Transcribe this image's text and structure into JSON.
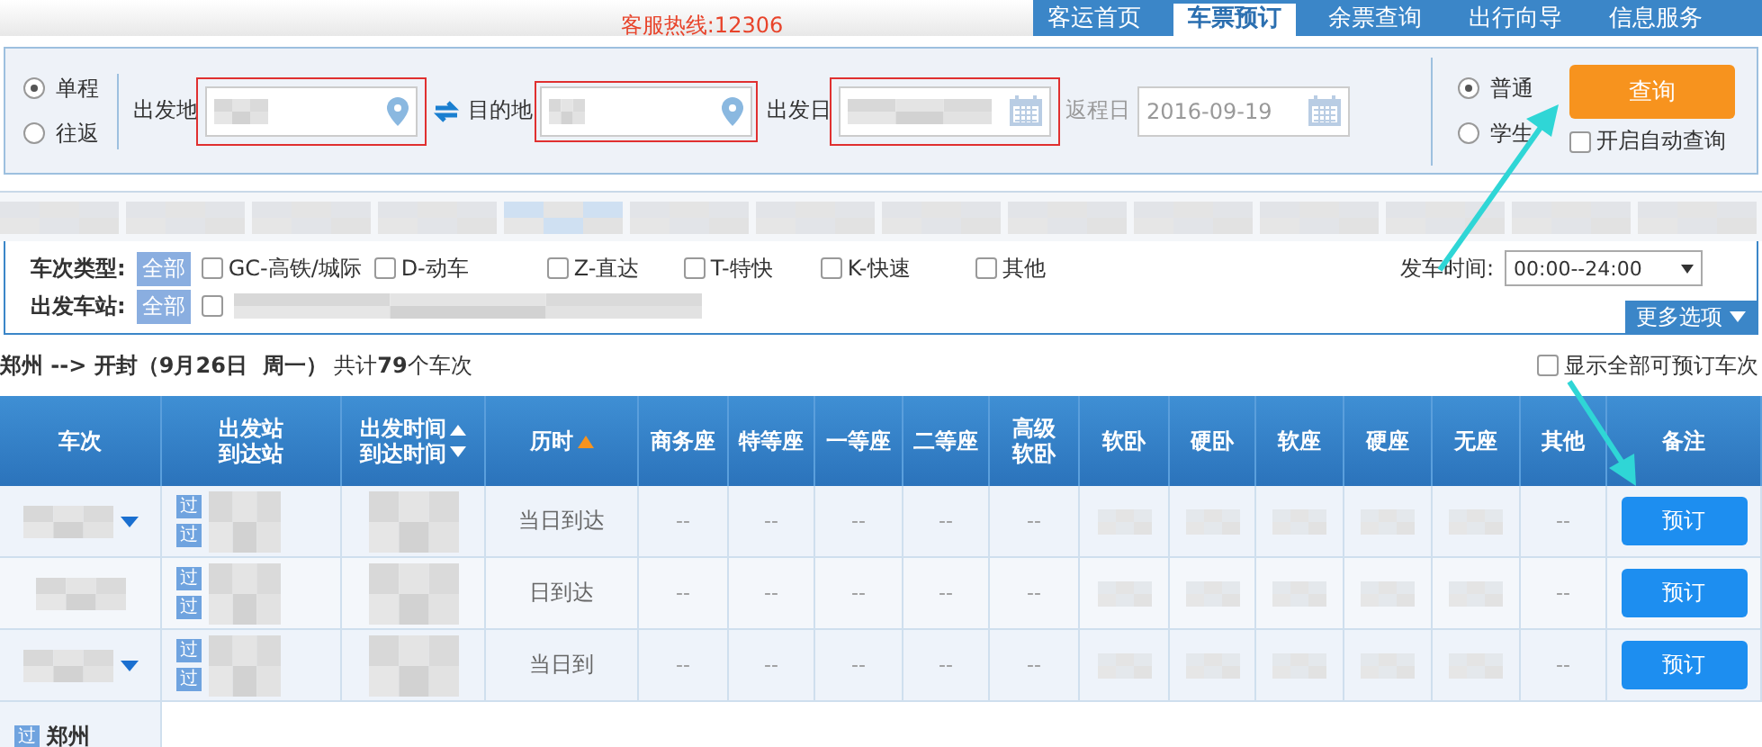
{
  "header": {
    "hotline": "客服热线:12306",
    "nav": [
      {
        "label": "客运首页",
        "selected": false
      },
      {
        "label": "车票预订",
        "selected": true
      },
      {
        "label": "余票查询",
        "selected": false
      },
      {
        "label": "出行向导",
        "selected": false
      },
      {
        "label": "信息服务",
        "selected": false
      }
    ]
  },
  "search": {
    "trip_types": [
      {
        "label": "单程",
        "selected": true
      },
      {
        "label": "往返",
        "selected": false
      }
    ],
    "from_label": "出发地",
    "to_label": "目的地",
    "date_label": "出发日",
    "return_label": "返程日",
    "return_date": "2016-09-19",
    "passenger_types": [
      {
        "label": "普通",
        "selected": true
      },
      {
        "label": "学生",
        "selected": false
      }
    ],
    "query_button": "查询",
    "auto_query": {
      "label": "开启自动查询",
      "checked": false
    }
  },
  "filters": {
    "type_label": "车次类型:",
    "type_all": "全部",
    "train_types": [
      {
        "label": "GC-高铁/城际",
        "checked": false
      },
      {
        "label": "D-动车",
        "checked": false
      },
      {
        "label": "Z-直达",
        "checked": false
      },
      {
        "label": "T-特快",
        "checked": false
      },
      {
        "label": "K-快速",
        "checked": false
      },
      {
        "label": "其他",
        "checked": false
      }
    ],
    "time_label": "发车时间:",
    "time_value": "00:00--24:00",
    "station_label": "出发车站:",
    "station_all": "全部",
    "station_checkbox": {
      "checked": false
    },
    "more_button": "更多选项"
  },
  "summary": {
    "route": "郑州 --> 开封（9月26日  周一）",
    "count": "共计**79**个车次",
    "show_all": {
      "label": "显示全部可预订车次",
      "checked": false
    }
  },
  "table": {
    "columns": [
      {
        "lines": [
          "车次"
        ],
        "kind": "plain"
      },
      {
        "lines": [
          "出发站",
          "到达站"
        ],
        "kind": "plain"
      },
      {
        "lines": [
          "出发时间",
          "到达时间"
        ],
        "kind": "sortboth"
      },
      {
        "lines": [
          "历时"
        ],
        "kind": "sortup"
      },
      {
        "lines": [
          "商务座"
        ],
        "kind": "plain"
      },
      {
        "lines": [
          "特等座"
        ],
        "kind": "plain"
      },
      {
        "lines": [
          "一等座"
        ],
        "kind": "plain"
      },
      {
        "lines": [
          "二等座"
        ],
        "kind": "plain"
      },
      {
        "lines": [
          "高级",
          "软卧"
        ],
        "kind": "plain"
      },
      {
        "lines": [
          "软卧"
        ],
        "kind": "plain"
      },
      {
        "lines": [
          "硬卧"
        ],
        "kind": "plain"
      },
      {
        "lines": [
          "软座"
        ],
        "kind": "plain"
      },
      {
        "lines": [
          "硬座"
        ],
        "kind": "plain"
      },
      {
        "lines": [
          "无座"
        ],
        "kind": "plain"
      },
      {
        "lines": [
          "其他"
        ],
        "kind": "plain"
      },
      {
        "lines": [
          "备注"
        ],
        "kind": "plain"
      }
    ],
    "rows": [
      {
        "caret": true,
        "via": [
          "过",
          "过"
        ],
        "duration": "当日到达",
        "seats": [
          {
            "kind": "text",
            "text": "--"
          },
          {
            "kind": "text",
            "text": "--"
          },
          {
            "kind": "text",
            "text": "--"
          },
          {
            "kind": "text",
            "text": "--"
          },
          {
            "kind": "text",
            "text": "--"
          },
          {
            "kind": "picture"
          },
          {
            "kind": "picture"
          },
          {
            "kind": "picture"
          },
          {
            "kind": "picture"
          },
          {
            "kind": "picture"
          },
          {
            "kind": "text",
            "text": "--"
          }
        ],
        "button": "预订"
      },
      {
        "caret": false,
        "via": [
          "过",
          "过"
        ],
        "duration": "日到达",
        "seats": [
          {
            "kind": "text",
            "text": "--"
          },
          {
            "kind": "text",
            "text": "--"
          },
          {
            "kind": "text",
            "text": "--"
          },
          {
            "kind": "text",
            "text": "--"
          },
          {
            "kind": "text",
            "text": "--"
          },
          {
            "kind": "picture"
          },
          {
            "kind": "picture"
          },
          {
            "kind": "picture"
          },
          {
            "kind": "picture"
          },
          {
            "kind": "picture"
          },
          {
            "kind": "text",
            "text": "--"
          }
        ],
        "button": "预订"
      },
      {
        "caret": true,
        "via": [
          "过",
          "过"
        ],
        "duration": "当日到",
        "seats": [
          {
            "kind": "text",
            "text": "--"
          },
          {
            "kind": "text",
            "text": "--"
          },
          {
            "kind": "text",
            "text": "--"
          },
          {
            "kind": "text",
            "text": "--"
          },
          {
            "kind": "text",
            "text": "--"
          },
          {
            "kind": "picture"
          },
          {
            "kind": "picture"
          },
          {
            "kind": "picture"
          },
          {
            "kind": "picture"
          },
          {
            "kind": "picture"
          },
          {
            "kind": "text",
            "text": "--"
          }
        ],
        "button": "预订"
      }
    ],
    "partial_row": {
      "via": "过",
      "station": "郑州"
    }
  }
}
